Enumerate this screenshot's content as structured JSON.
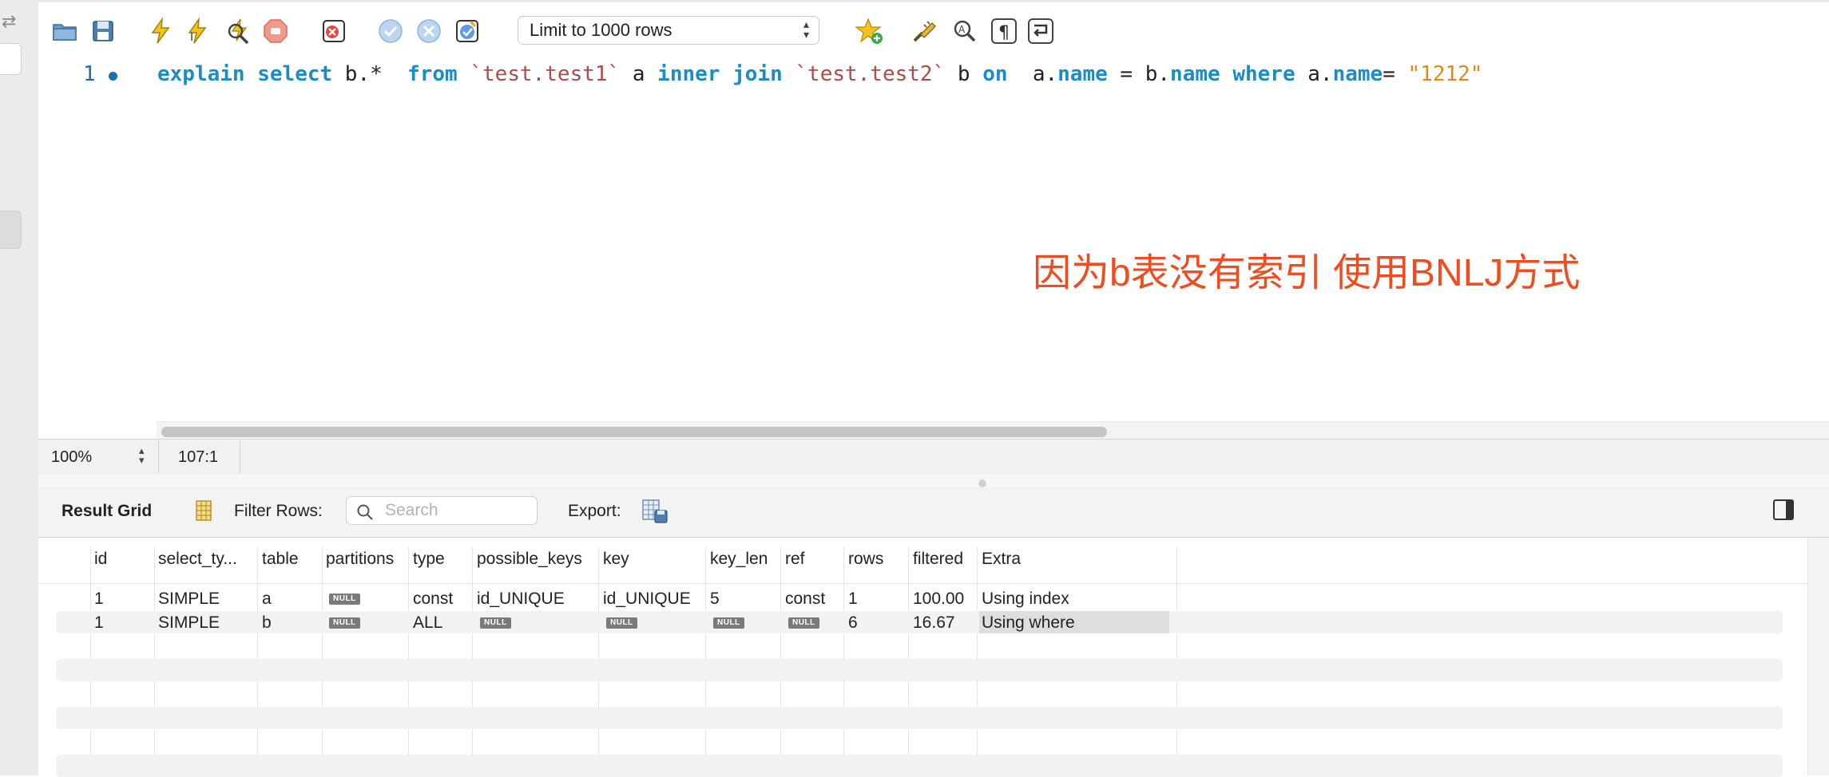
{
  "toolbar": {
    "limit_select": "Limit to 1000 rows",
    "icons": [
      "open-folder-icon",
      "save-icon",
      "execute-icon",
      "execute-current-icon",
      "explain-icon",
      "stop-icon",
      "toggle-error-icon",
      "commit-icon",
      "rollback-icon",
      "autocommit-icon",
      "bookmark-icon",
      "beautify-icon",
      "find-icon",
      "invisible-chars-icon",
      "wrap-icon"
    ]
  },
  "editor": {
    "line_number": "1",
    "code": {
      "t01": "explain",
      "t02": " ",
      "t03": "select",
      "t04": " b.*  ",
      "t05": "from",
      "t06": " ",
      "t07": "`test.test1`",
      "t08": " a ",
      "t09": "inner",
      "t10": " ",
      "t11": "join",
      "t12": " ",
      "t13": "`test.test2`",
      "t14": " b ",
      "t15": "on",
      "t16": "  a.",
      "t17": "name",
      "t18": " = b.",
      "t19": "name",
      "t20": " ",
      "t21": "where",
      "t22": " a.",
      "t23": "name",
      "t24": "= ",
      "t25": "\"1212\""
    },
    "annotation": "因为b表没有索引  使用BNLJ方式"
  },
  "statusbar": {
    "zoom": "100%",
    "cursor": "107:1"
  },
  "result": {
    "result_grid_label": "Result Grid",
    "filter_label": "Filter Rows:",
    "search_placeholder": "Search",
    "export_label": "Export:",
    "null_badge": "NULL",
    "columns": [
      "id",
      "select_ty...",
      "table",
      "partitions",
      "type",
      "possible_keys",
      "key",
      "key_len",
      "ref",
      "rows",
      "filtered",
      "Extra"
    ],
    "rows": [
      [
        "1",
        "SIMPLE",
        "a",
        "NULL",
        "const",
        "id_UNIQUE",
        "id_UNIQUE",
        "5",
        "const",
        "1",
        "100.00",
        "Using index"
      ],
      [
        "1",
        "SIMPLE",
        "b",
        "NULL",
        "ALL",
        "NULL",
        "NULL",
        "NULL",
        "NULL",
        "6",
        "16.67",
        "Using where"
      ]
    ]
  },
  "colors": {
    "keyword": "#1a8cc7",
    "table_ident": "#b04a4a",
    "string": "#e08a1a",
    "annotation": "#ee4d20",
    "line_number": "#1a6fb0"
  }
}
